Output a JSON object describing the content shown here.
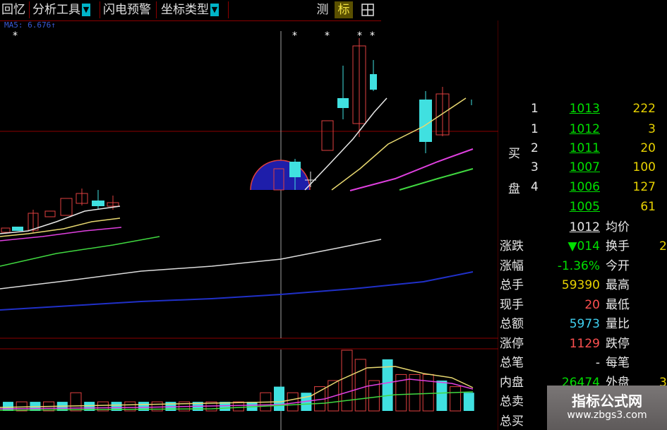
{
  "toolbar": {
    "recall": "回忆",
    "analysis_tools": "分析工具",
    "flash_alert": "闪电预警",
    "coordinate_type": "坐标类型",
    "measure": "测",
    "mark": "标",
    "grid_icon": "grid-icon",
    "dropdown_icon": "triangle-down-icon",
    "colors": {
      "text": "#e0e0e0",
      "divider": "#8b0000",
      "arrow_bg": "#00b4c8"
    }
  },
  "indicator": {
    "label": "MA5: 6.676↑"
  },
  "chart_data": {
    "type": "candlestick",
    "title": "",
    "xlabel": "",
    "ylabel": "",
    "colors": {
      "up": "#e04040",
      "down": "#40e0e0",
      "ma5": "#e8e8e8",
      "ma10": "#e8d870",
      "ma20": "#e040e0",
      "ma60": "#40d840",
      "ma120": "#2020c0",
      "grid": "#8b0000"
    },
    "note_marks": [
      "*",
      "*",
      "*",
      "*",
      "*"
    ],
    "volume": [
      3,
      3,
      3,
      3,
      3,
      6,
      3,
      3,
      3,
      3,
      3,
      3,
      3,
      3,
      3,
      3,
      3,
      3,
      3,
      6,
      8,
      6,
      6,
      8,
      10,
      20,
      17,
      10,
      17,
      12,
      12,
      12,
      10,
      8,
      6
    ]
  },
  "quote_panel": {
    "buy_label": [
      "买",
      "盘"
    ],
    "bids": [
      {
        "level": "1",
        "price": "1013",
        "volume": "222"
      },
      {
        "level": "1",
        "price": "1012",
        "volume": "3"
      },
      {
        "level": "2",
        "price": "1011",
        "volume": "20"
      },
      {
        "level": "3",
        "price": "1007",
        "volume": "100"
      },
      {
        "level": "4",
        "price": "1006",
        "volume": "127"
      },
      {
        "level": "",
        "price": "1005",
        "volume": "61"
      }
    ],
    "avg_price": {
      "value": "1012",
      "label": "均价"
    },
    "stats": [
      {
        "label": "涨跌",
        "value": "▼014",
        "value_color": "#00e000",
        "right_label": "换手",
        "right_value": "2"
      },
      {
        "label": "涨幅",
        "value": "-1.36%",
        "value_color": "#00e000",
        "right_label": "今开",
        "right_value": ""
      },
      {
        "label": "总手",
        "value": "59390",
        "value_color": "#e8d200",
        "right_label": "最高",
        "right_value": ""
      },
      {
        "label": "现手",
        "value": "20",
        "value_color": "#ff5050",
        "right_label": "最低",
        "right_value": ""
      },
      {
        "label": "总额",
        "value": "5973",
        "value_color": "#40d0f0",
        "right_label": "量比",
        "right_value": ""
      },
      {
        "label": "涨停",
        "value": "1129",
        "value_color": "#ff5050",
        "right_label": "跌停",
        "right_value": ""
      },
      {
        "label": "总笔",
        "value": "-",
        "value_color": "#e8e8e8",
        "right_label": "每笔",
        "right_value": ""
      },
      {
        "label": "内盘",
        "value": "26474",
        "value_color": "#00e000",
        "right_label": "外盘",
        "right_value": "3"
      },
      {
        "label": "总卖",
        "value": "",
        "value_color": "#e8e8e8",
        "right_label": "",
        "right_value": ""
      },
      {
        "label": "总买",
        "value": "",
        "value_color": "#e8e8e8",
        "right_label": "",
        "right_value": ""
      }
    ]
  },
  "watermark": {
    "line1": "指标公式网",
    "line2": "www.zbgs3.com"
  }
}
